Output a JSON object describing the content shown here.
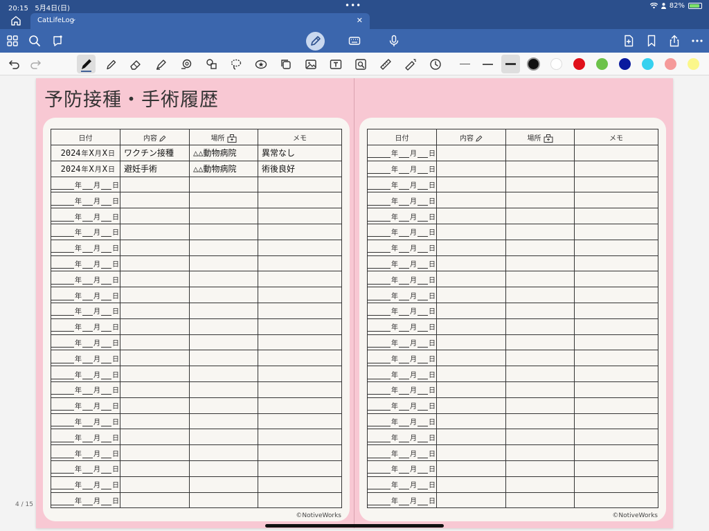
{
  "status": {
    "time": "20:15",
    "date": "5月4日(日)",
    "battery": "82%",
    "battery_level": 0.82
  },
  "tab": {
    "name": "CatLifeLog"
  },
  "page_indicator": "4 / 15",
  "title": "予防接種・手術履歴",
  "credit": "©NotiveWorks",
  "table": {
    "headers": [
      "日付",
      "内容",
      "場所",
      "メモ"
    ],
    "units": {
      "year": "年",
      "month": "月",
      "day": "日"
    }
  },
  "entries": [
    {
      "year": "2024",
      "month": "X",
      "day": "X",
      "content": "ワクチン接種",
      "place": "△△動物病院",
      "memo": "異常なし"
    },
    {
      "year": "2024",
      "month": "X",
      "day": "X",
      "content": "避妊手術",
      "place": "△△動物病院",
      "memo": "術後良好"
    }
  ],
  "colors": {
    "page_bg": "#f8c8d3",
    "swatches": [
      "#111111",
      "#ffffff",
      "#e0101a",
      "#6cc24a",
      "#0a1a9e",
      "#36d1ef",
      "#f59a9a",
      "#fbf78a"
    ]
  }
}
